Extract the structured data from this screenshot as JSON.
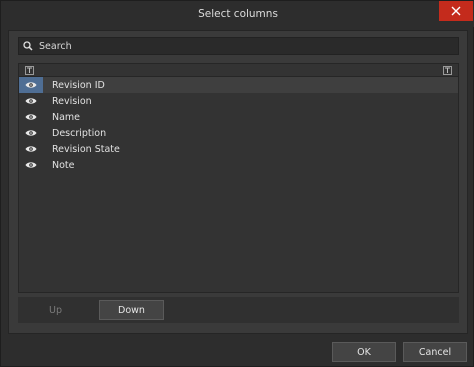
{
  "window": {
    "title": "Select columns"
  },
  "search": {
    "placeholder": "Search",
    "value": ""
  },
  "list": {
    "rows": [
      {
        "label": "Revision ID",
        "visible": true,
        "selected": true
      },
      {
        "label": "Revision",
        "visible": true,
        "selected": false
      },
      {
        "label": "Name",
        "visible": true,
        "selected": false
      },
      {
        "label": "Description",
        "visible": true,
        "selected": false
      },
      {
        "label": "Revision State",
        "visible": true,
        "selected": false
      },
      {
        "label": "Note",
        "visible": true,
        "selected": false
      }
    ]
  },
  "reorder": {
    "up_label": "Up",
    "down_label": "Down"
  },
  "footer": {
    "ok_label": "OK",
    "cancel_label": "Cancel"
  },
  "colors": {
    "close_button": "#c42b1c",
    "selection_accent": "#4f6e94"
  },
  "icons": {
    "row_icon": "eye-icon",
    "search": "search-icon",
    "close": "close-icon",
    "filter": "filter-icon"
  }
}
